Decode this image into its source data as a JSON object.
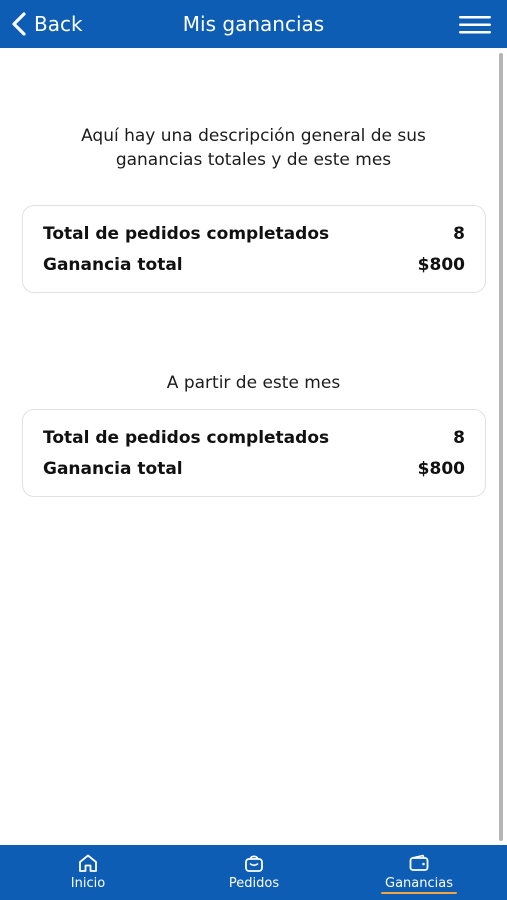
{
  "header": {
    "back_label": "Back",
    "title": "Mis ganancias"
  },
  "intro_text": "Aquí hay una descripción general de sus ganancias totales y de este mes",
  "totals_card": {
    "orders_label": "Total de pedidos completados",
    "orders_value": "8",
    "earnings_label": "Ganancia total",
    "earnings_value": "$800"
  },
  "month_section": {
    "subtitle": "A partir de este mes",
    "orders_label": "Total de pedidos completados",
    "orders_value": "8",
    "earnings_label": "Ganancia total",
    "earnings_value": "$800"
  },
  "bottom_nav": {
    "items": [
      {
        "label": "Inicio",
        "icon": "home-icon"
      },
      {
        "label": "Pedidos",
        "icon": "bag-icon"
      },
      {
        "label": "Ganancias",
        "icon": "wallet-icon",
        "active": true
      }
    ]
  },
  "colors": {
    "brand_blue": "#0d5db4",
    "active_underline": "#f4a340",
    "card_border": "#e2e2e2"
  }
}
